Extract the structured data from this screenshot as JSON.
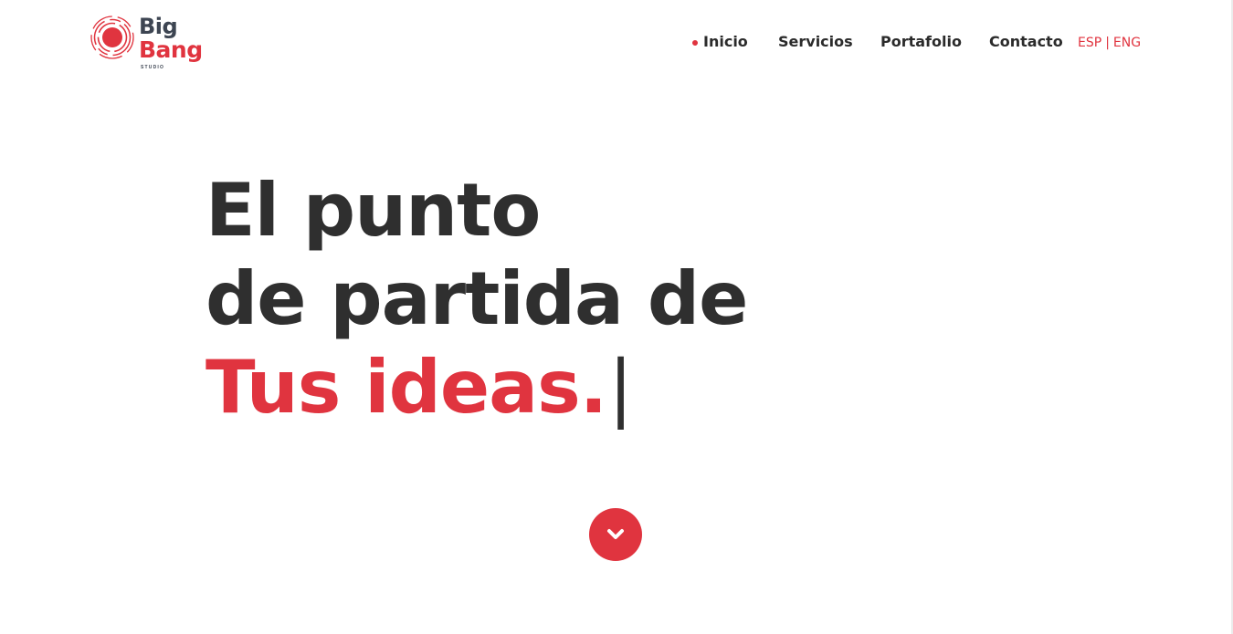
{
  "brand": {
    "word_top": "Big",
    "word_bottom": "Bang",
    "tagline": "STUDIO",
    "primary_color": "#e0343f",
    "dark_color": "#3d4552"
  },
  "nav": {
    "items": [
      {
        "label": "Inicio",
        "active": true
      },
      {
        "label": "Servicios",
        "active": false
      },
      {
        "label": "Portafolio",
        "active": false
      },
      {
        "label": "Contacto",
        "active": false
      }
    ],
    "lang": {
      "esp": "ESP",
      "separator": "|",
      "eng": "ENG"
    }
  },
  "hero": {
    "line1": "El punto",
    "line2": "de partida de",
    "line3": "Tus ideas.",
    "cursor": "|"
  },
  "scroll_button": {
    "icon": "chevron-down-icon"
  }
}
